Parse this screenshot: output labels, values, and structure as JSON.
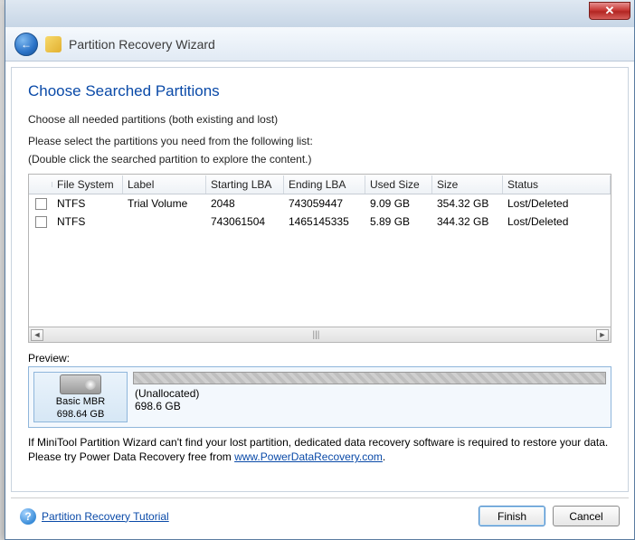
{
  "titlebar": {
    "close_glyph": "✕"
  },
  "header": {
    "title": "Partition Recovery Wizard",
    "back_glyph": "←"
  },
  "section_title": "Choose Searched Partitions",
  "instruction": "Choose all needed partitions (both existing and lost)",
  "instruction2_line1": "Please select the partitions you need from the following list:",
  "instruction2_line2": "(Double click the searched partition to explore the content.)",
  "columns": {
    "check": "",
    "file_system": "File System",
    "label": "Label",
    "starting_lba": "Starting LBA",
    "ending_lba": "Ending LBA",
    "used_size": "Used Size",
    "size": "Size",
    "status": "Status"
  },
  "rows": [
    {
      "file_system": "NTFS",
      "label": "Trial Volume",
      "starting_lba": "2048",
      "ending_lba": "743059447",
      "used_size": "9.09 GB",
      "size": "354.32 GB",
      "status": "Lost/Deleted"
    },
    {
      "file_system": "NTFS",
      "label": "",
      "starting_lba": "743061504",
      "ending_lba": "1465145335",
      "used_size": "5.89 GB",
      "size": "344.32 GB",
      "status": "Lost/Deleted"
    }
  ],
  "scroll": {
    "left": "◄",
    "right": "►",
    "grip": "|||"
  },
  "preview": {
    "label": "Preview:",
    "disk_type": "Basic MBR",
    "disk_size": "698.64 GB",
    "alloc_label": "(Unallocated)",
    "alloc_size": "698.6 GB"
  },
  "note": {
    "text1": "If MiniTool Partition Wizard can't find your lost partition, dedicated data recovery software is required to restore your data. Please try Power Data Recovery free from ",
    "link_text": "www.PowerDataRecovery.com",
    "text2": "."
  },
  "footer": {
    "tutorial_label": "Partition Recovery Tutorial",
    "help_glyph": "?",
    "finish": "Finish",
    "cancel": "Cancel"
  }
}
